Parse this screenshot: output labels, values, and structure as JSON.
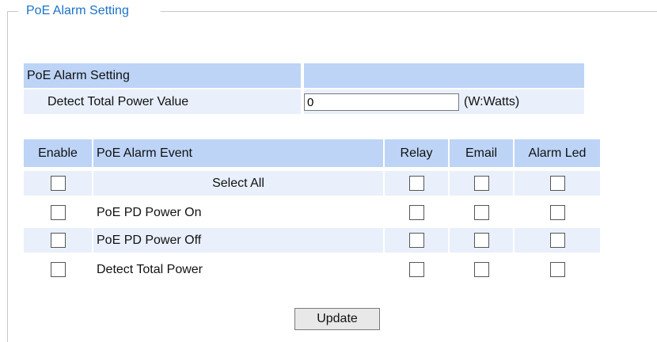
{
  "legend": "PoE Alarm Setting",
  "setting_table": {
    "header": "PoE Alarm Setting",
    "row_label": "Detect Total Power Value",
    "input_value": "0",
    "unit": "(W:Watts)"
  },
  "event_table": {
    "headers": {
      "enable": "Enable",
      "event": "PoE Alarm Event",
      "relay": "Relay",
      "email": "Email",
      "alarm_led": "Alarm Led"
    },
    "rows": [
      {
        "event": "Select All"
      },
      {
        "event": "PoE PD Power On"
      },
      {
        "event": "PoE PD Power Off"
      },
      {
        "event": "Detect Total Power"
      }
    ]
  },
  "update_label": "Update"
}
